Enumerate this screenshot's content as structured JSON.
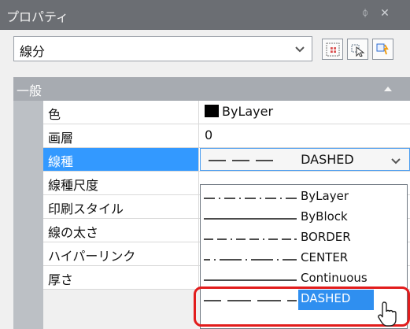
{
  "window": {
    "title": "プロパティ",
    "pin_glyph": "ᛰ",
    "close_glyph": "✕"
  },
  "object_selector": {
    "value": "線分",
    "arrow": "⌄"
  },
  "section": {
    "label": "一般"
  },
  "properties": [
    {
      "label": "色",
      "value": "ByLayer",
      "swatch": "#000000"
    },
    {
      "label": "画層",
      "value": "0"
    },
    {
      "label": "線種",
      "value": "DASHED",
      "active": true
    },
    {
      "label": "線種尺度",
      "value": ""
    },
    {
      "label": "印刷スタイル",
      "value": ""
    },
    {
      "label": "線の太さ",
      "value": ""
    },
    {
      "label": "ハイパーリンク",
      "value": ""
    },
    {
      "label": "厚さ",
      "value": ""
    }
  ],
  "linetype_dropdown": {
    "selected": "DASHED",
    "options": [
      {
        "label": "ByLayer",
        "pattern": "dashdot"
      },
      {
        "label": "ByBlock",
        "pattern": "solid"
      },
      {
        "label": "BORDER",
        "pattern": "border"
      },
      {
        "label": "CENTER",
        "pattern": "center"
      },
      {
        "label": "Continuous",
        "pattern": "solid"
      },
      {
        "label": "DASHED",
        "pattern": "dashed"
      }
    ]
  },
  "colors": {
    "highlight": "#3399ff",
    "callout": "#e21c1c",
    "section_bg": "#a7abb1"
  }
}
